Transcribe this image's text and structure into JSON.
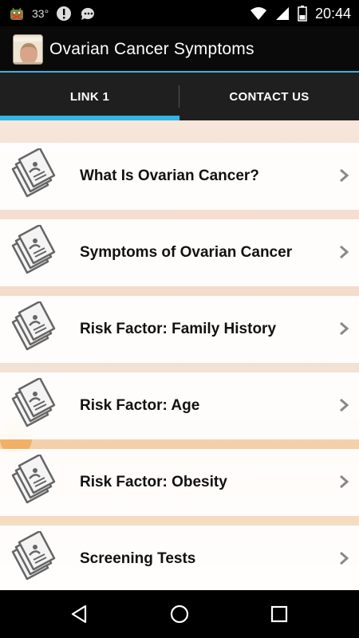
{
  "status_bar": {
    "temperature": "33°",
    "time": "20:44",
    "icons": [
      "android-debug-icon",
      "alert-icon",
      "chat-bubble-icon",
      "wifi-icon",
      "signal-icon",
      "battery-icon"
    ]
  },
  "action_bar": {
    "title": "Ovarian Cancer Symptoms",
    "app_icon": "app-logo-icon",
    "accent_color": "#33b5e5"
  },
  "tabs": [
    {
      "label": "LINK 1",
      "selected": true
    },
    {
      "label": "CONTACT US",
      "selected": false
    }
  ],
  "list": {
    "item_icon": "document-stack-icon",
    "chevron_icon": "chevron-right-icon",
    "items": [
      {
        "label": "What Is Ovarian Cancer?"
      },
      {
        "label": "Symptoms of Ovarian Cancer"
      },
      {
        "label": "Risk Factor: Family History"
      },
      {
        "label": "Risk Factor: Age"
      },
      {
        "label": "Risk Factor: Obesity"
      },
      {
        "label": "Screening Tests"
      }
    ]
  },
  "nav_bar": {
    "buttons": [
      "back-icon",
      "home-icon",
      "recents-icon"
    ]
  }
}
